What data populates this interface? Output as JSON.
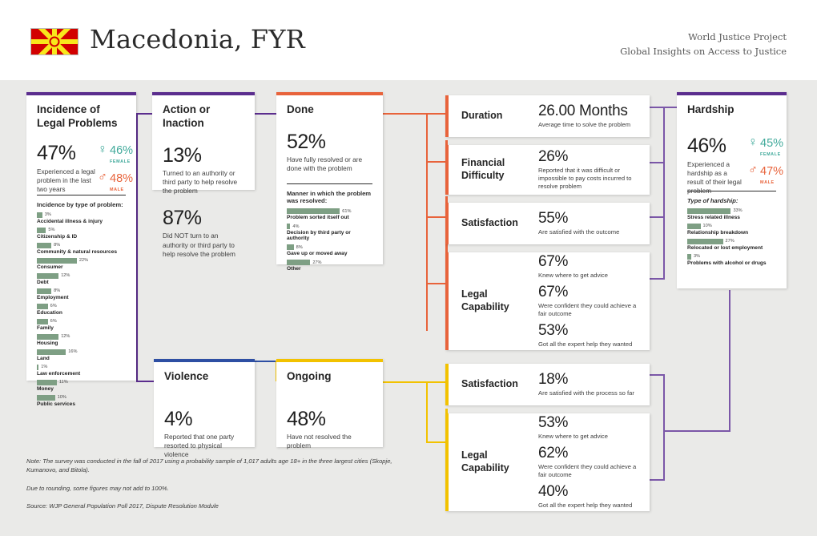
{
  "header": {
    "country": "Macedonia, FYR",
    "org_line1": "World Justice Project",
    "org_line2": "Global Insights on Access to Justice",
    "flag_icon": "macedonia-flag-icon"
  },
  "colors": {
    "purple": "#5b2d8e",
    "orange": "#e8633b",
    "yellow": "#f2c200",
    "blue": "#2e4fa3",
    "bar_green": "#7e9f84",
    "female": "#3fa99a",
    "male": "#e8633b"
  },
  "cards": {
    "incidence": {
      "title": "Incidence of\nLegal Problems",
      "title_l1": "Incidence of",
      "title_l2": "Legal Problems",
      "stat": "47%",
      "desc": "Experienced a legal problem in the last two years",
      "female_value": "46%",
      "female_label": "FEMALE",
      "male_value": "48%",
      "male_label": "MALE",
      "breakdown_label": "Incidence by type of problem:",
      "breakdown": [
        {
          "label": "Accidental illness & injury",
          "value": 3,
          "text": "3%"
        },
        {
          "label": "Citizenship & ID",
          "value": 5,
          "text": "5%"
        },
        {
          "label": "Community & natural resources",
          "value": 8,
          "text": "8%"
        },
        {
          "label": "Consumer",
          "value": 22,
          "text": "22%"
        },
        {
          "label": "Debt",
          "value": 12,
          "text": "12%"
        },
        {
          "label": "Employment",
          "value": 8,
          "text": "8%"
        },
        {
          "label": "Education",
          "value": 6,
          "text": "6%"
        },
        {
          "label": "Family",
          "value": 6,
          "text": "6%"
        },
        {
          "label": "Housing",
          "value": 12,
          "text": "12%"
        },
        {
          "label": "Land",
          "value": 16,
          "text": "16%"
        },
        {
          "label": "Law enforcement",
          "value": 1,
          "text": "1%"
        },
        {
          "label": "Money",
          "value": 11,
          "text": "11%"
        },
        {
          "label": "Public services",
          "value": 10,
          "text": "10%"
        }
      ]
    },
    "action": {
      "title": "Action or Inaction",
      "stat1": "13%",
      "desc1": "Turned to an authority or third party to help resolve the problem",
      "stat2": "87%",
      "desc2": "Did NOT turn to an authority or third party to help resolve the problem"
    },
    "done": {
      "title": "Done",
      "stat": "52%",
      "desc": "Have fully resolved or are done with the problem",
      "breakdown_label": "Manner in which the problem was resolved:",
      "breakdown": [
        {
          "label": "Problem sorted itself out",
          "value": 61,
          "text": "61%"
        },
        {
          "label": "Decision by third party or authority",
          "value": 4,
          "text": "4%"
        },
        {
          "label": "Gave up or moved away",
          "value": 8,
          "text": "8%"
        },
        {
          "label": "Other",
          "value": 27,
          "text": "27%"
        }
      ]
    },
    "hardship": {
      "title": "Hardship",
      "stat": "46%",
      "desc": "Experienced a hardship as a result of their legal problem",
      "female_value": "45%",
      "female_label": "FEMALE",
      "male_value": "47%",
      "male_label": "MALE",
      "breakdown_label": "Type of hardship:",
      "breakdown": [
        {
          "label": "Stress related illness",
          "value": 33,
          "text": "33%"
        },
        {
          "label": "Relationship breakdown",
          "value": 10,
          "text": "10%"
        },
        {
          "label": "Relocated or lost employment",
          "value": 27,
          "text": "27%"
        },
        {
          "label": "Problems with alcohol or drugs",
          "value": 3,
          "text": "3%"
        }
      ]
    },
    "violence": {
      "title": "Violence",
      "stat": "4%",
      "desc": "Reported that one party resorted to physical violence"
    },
    "ongoing": {
      "title": "Ongoing",
      "stat": "48%",
      "desc": "Have not resolved the problem"
    }
  },
  "done_stats": [
    {
      "label": "Duration",
      "label_l1": "Duration",
      "label_l2": "",
      "rows": [
        {
          "num": "26.00 Months",
          "desc": "Average time to solve the problem"
        }
      ]
    },
    {
      "label": "Financial Difficulty",
      "label_l1": "Financial",
      "label_l2": "Difficulty",
      "rows": [
        {
          "num": "26%",
          "desc": "Reported that it was difficult or impossible to pay costs incurred to resolve problem"
        }
      ]
    },
    {
      "label": "Satisfaction",
      "label_l1": "Satisfaction",
      "label_l2": "",
      "rows": [
        {
          "num": "55%",
          "desc": "Are satisfied with the outcome"
        }
      ]
    },
    {
      "label": "Legal Capability",
      "label_l1": "Legal",
      "label_l2": "Capability",
      "rows": [
        {
          "num": "67%",
          "desc": "Knew where to get advice"
        },
        {
          "num": "67%",
          "desc": "Were confident they could achieve a fair outcome"
        },
        {
          "num": "53%",
          "desc": "Got all the expert help they wanted"
        }
      ]
    }
  ],
  "ongoing_stats": [
    {
      "label": "Satisfaction",
      "label_l1": "Satisfaction",
      "label_l2": "",
      "rows": [
        {
          "num": "18%",
          "desc": "Are satisfied with the process so far"
        }
      ]
    },
    {
      "label": "Legal Capability",
      "label_l1": "Legal",
      "label_l2": "Capability",
      "rows": [
        {
          "num": "53%",
          "desc": "Knew where to get advice"
        },
        {
          "num": "62%",
          "desc": "Were confident they could achieve a fair outcome"
        },
        {
          "num": "40%",
          "desc": "Got all the expert help they wanted"
        }
      ]
    }
  ],
  "notes": {
    "note": "Note: The survey was conducted in the fall of 2017 using a probability sample of 1,017 adults age 18+ in the three largest cities (Skopje, Kumanovo, and Bitola).",
    "rounding": "Due to rounding, some figures may not add to 100%.",
    "source": "Source: WJP General Population Poll 2017, Dispute Resolution Module"
  }
}
